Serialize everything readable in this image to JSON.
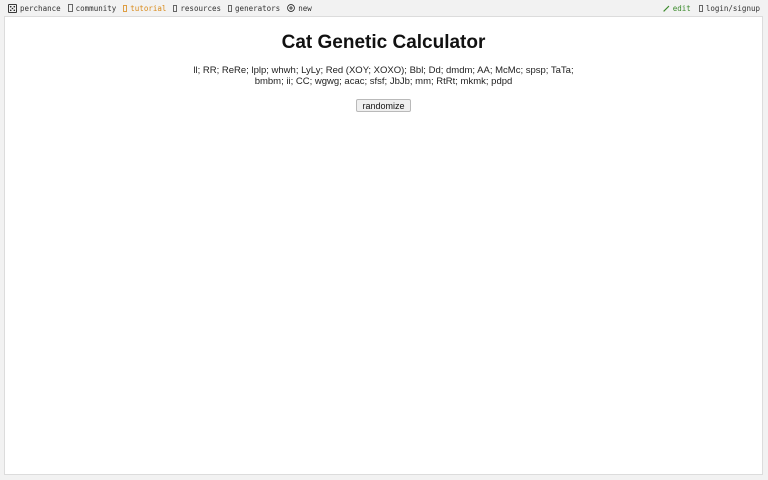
{
  "nav": {
    "left": [
      {
        "label": "perchance",
        "icon": "dice-icon"
      },
      {
        "label": "community",
        "icon": "people-icon"
      },
      {
        "label": "tutorial",
        "icon": "book-icon"
      },
      {
        "label": "resources",
        "icon": "folder-icon"
      },
      {
        "label": "generators",
        "icon": "grid-icon"
      },
      {
        "label": "new",
        "icon": "plus-circle-icon"
      }
    ],
    "right": [
      {
        "label": "edit",
        "icon": "pencil-icon"
      },
      {
        "label": "login/signup",
        "icon": "user-icon"
      }
    ],
    "active": "tutorial",
    "colors": {
      "active": "#d98a1a",
      "edit": "#3a8a2a"
    }
  },
  "page": {
    "title": "Cat Genetic Calculator",
    "genes_line1": "ll; RR; ReRe; lplp; whwh; LyLy; Red (XOY; XOXO); Bbl; Dd; dmdm; AA; McMc; spsp; TaTa;",
    "genes_line2": "bmbm; ii; CC; wgwg; acac; sfsf; JbJb; mm; RtRt; mkmk; pdpd",
    "randomize_label": "randomize"
  }
}
